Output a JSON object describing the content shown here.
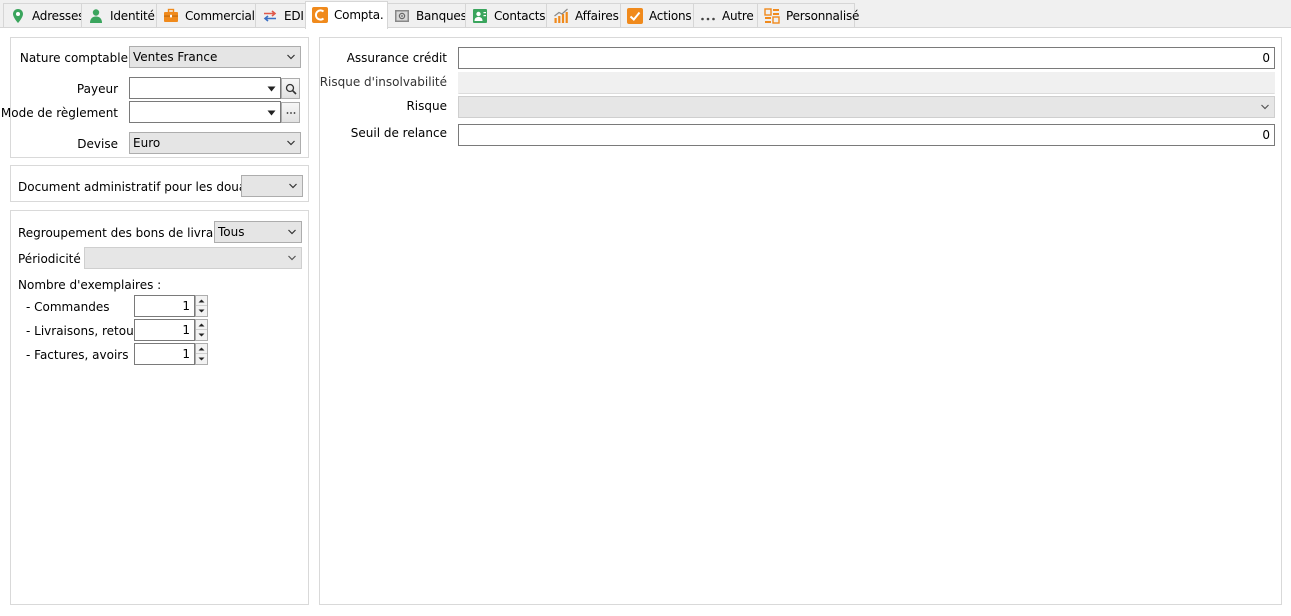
{
  "tabs": [
    {
      "id": "adresses",
      "label": "Adresses",
      "icon": "map-pin-icon",
      "active": false
    },
    {
      "id": "identite",
      "label": "Identité",
      "icon": "person-icon",
      "active": false
    },
    {
      "id": "commercial",
      "label": "Commercial",
      "icon": "briefcase-icon",
      "active": false
    },
    {
      "id": "edi",
      "label": "EDI",
      "icon": "exchange-arrows-icon",
      "active": false
    },
    {
      "id": "compta",
      "label": "Compta.",
      "icon": "accounting-c-icon",
      "active": true
    },
    {
      "id": "banques",
      "label": "Banques",
      "icon": "safe-icon",
      "active": false
    },
    {
      "id": "contacts",
      "label": "Contacts",
      "icon": "contact-card-icon",
      "active": false
    },
    {
      "id": "affaires",
      "label": "Affaires",
      "icon": "growth-chart-icon",
      "active": false
    },
    {
      "id": "actions",
      "label": "Actions",
      "icon": "checkmark-icon",
      "active": false
    },
    {
      "id": "autre",
      "label": "Autre",
      "icon": "more-dots-icon",
      "active": false
    },
    {
      "id": "personnalise",
      "label": "Personnalisé",
      "icon": "custom-form-icon",
      "active": false
    }
  ],
  "left": {
    "nature_comptable": {
      "label": "Nature comptable",
      "value": "Ventes France"
    },
    "payeur": {
      "label": "Payeur",
      "value": ""
    },
    "mode_reglement": {
      "label": "Mode de règlement",
      "value": ""
    },
    "devise": {
      "label": "Devise",
      "value": "Euro"
    },
    "douanes": {
      "label": "Document administratif pour les douanes",
      "value": ""
    },
    "regroupement": {
      "label": "Regroupement des bons de livraison",
      "value": "Tous"
    },
    "periodicite": {
      "label": "Périodicité",
      "value": ""
    },
    "exemplaires": {
      "title": "Nombre d'exemplaires :",
      "commandes": {
        "label": "- Commandes",
        "value": "1"
      },
      "livraisons": {
        "label": "- Livraisons, retours",
        "value": "1"
      },
      "factures": {
        "label": "- Factures, avoirs",
        "value": "1"
      }
    }
  },
  "right": {
    "assurance_credit": {
      "label": "Assurance crédit",
      "value": "0"
    },
    "risque_insolvabilite": {
      "label": "Risque d'insolvabilité",
      "value": ""
    },
    "risque": {
      "label": "Risque",
      "value": ""
    },
    "seuil_relance": {
      "label": "Seuil de relance",
      "value": "0"
    }
  },
  "colors": {
    "tab_bg": "#f0f0f0",
    "active_tab_bg": "#ffffff",
    "accent_orange": "#f08a1c",
    "green_icon": "#3aa55d"
  }
}
